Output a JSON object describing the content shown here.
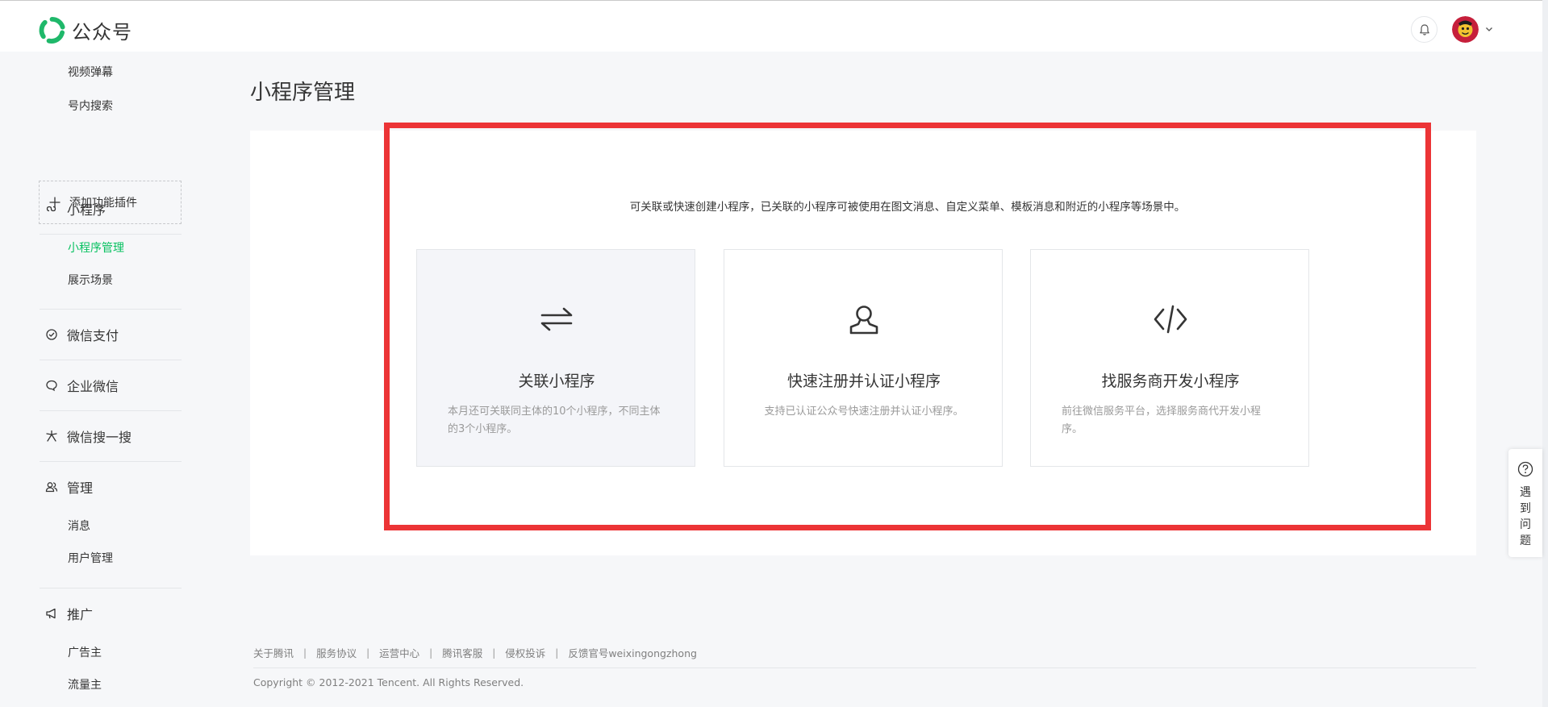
{
  "header": {
    "logo_text": "公众号"
  },
  "sidebar": {
    "top_items": [
      {
        "label": "视频弹幕"
      },
      {
        "label": "号内搜索"
      }
    ],
    "add_plugin_label": "添加功能插件",
    "groups": {
      "mini_program": {
        "label": "小程序",
        "items": [
          {
            "label": "小程序管理",
            "active": true
          },
          {
            "label": "展示场景"
          }
        ]
      },
      "wechat_pay": {
        "label": "微信支付"
      },
      "work_wechat": {
        "label": "企业微信"
      },
      "search": {
        "label": "微信搜一搜"
      },
      "manage": {
        "label": "管理",
        "items": [
          {
            "label": "消息"
          },
          {
            "label": "用户管理"
          }
        ]
      },
      "promote": {
        "label": "推广",
        "items": [
          {
            "label": "广告主"
          },
          {
            "label": "流量主"
          }
        ]
      }
    }
  },
  "main": {
    "title": "小程序管理",
    "description": "可关联或快速创建小程序，已关联的小程序可被使用在图文消息、自定义菜单、模板消息和附近的小程序等场景中。",
    "cards": [
      {
        "title": "关联小程序",
        "desc": "本月还可关联同主体的10个小程序，不同主体的3个小程序。",
        "icon": "swap-arrows-icon"
      },
      {
        "title": "快速注册并认证小程序",
        "desc": "支持已认证公众号快速注册并认证小程序。",
        "icon": "user-icon"
      },
      {
        "title": "找服务商开发小程序",
        "desc": "前往微信服务平台，选择服务商代开发小程序。",
        "icon": "code-icon"
      }
    ]
  },
  "footer": {
    "links": [
      "关于腾讯",
      "服务协议",
      "运营中心",
      "腾讯客服",
      "侵权投诉",
      "反馈官号weixingongzhong"
    ],
    "copyright": "Copyright © 2012-2021 Tencent. All Rights Reserved."
  },
  "help": {
    "label": "遇到问题"
  },
  "colors": {
    "brand_green": "#07c160",
    "highlight_red": "#ec3436"
  }
}
